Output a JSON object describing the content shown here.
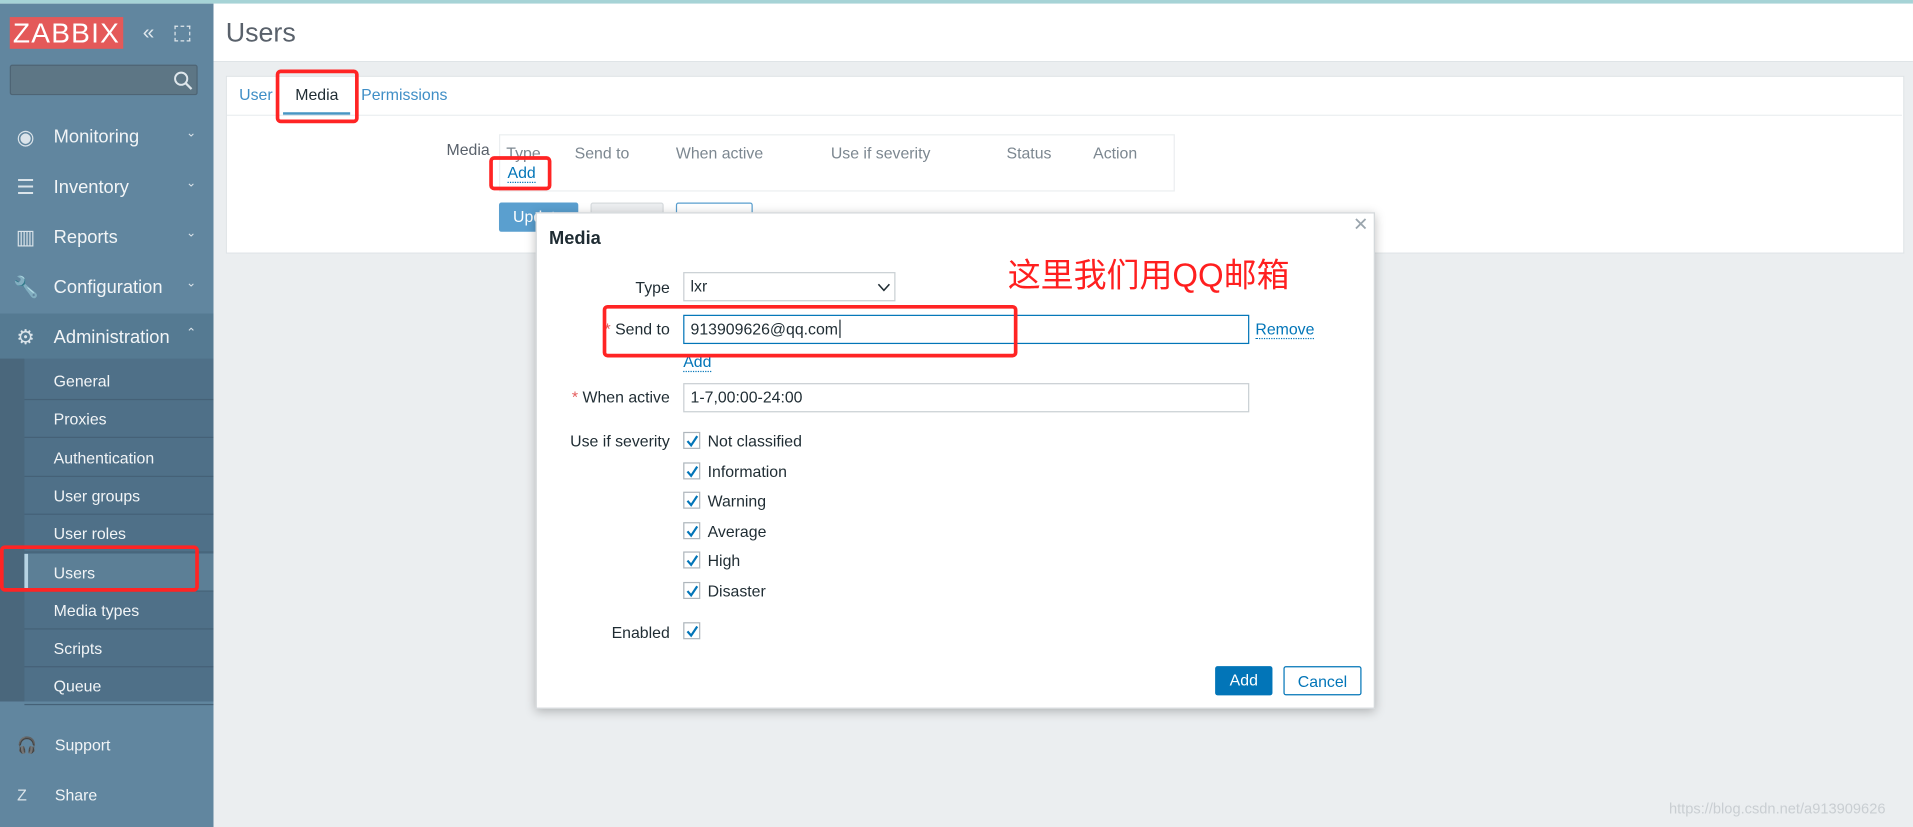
{
  "brand": {
    "logo": "ZABBIX"
  },
  "sidebar": {
    "search_placeholder": "",
    "menu": [
      {
        "label": "Monitoring",
        "icon": "eye-icon"
      },
      {
        "label": "Inventory",
        "icon": "list-icon"
      },
      {
        "label": "Reports",
        "icon": "bar-chart-icon"
      },
      {
        "label": "Configuration",
        "icon": "wrench-icon"
      },
      {
        "label": "Administration",
        "icon": "gear-icon",
        "expanded": true
      }
    ],
    "admin_items": [
      "General",
      "Proxies",
      "Authentication",
      "User groups",
      "User roles",
      "Users",
      "Media types",
      "Scripts",
      "Queue"
    ],
    "selected": "Users",
    "footer": [
      {
        "label": "Support",
        "icon": "headset-icon"
      },
      {
        "label": "Share",
        "icon": "zabbix-share-icon"
      }
    ]
  },
  "page": {
    "title": "Users"
  },
  "tabs": [
    {
      "label": "User"
    },
    {
      "label": "Media",
      "active": true
    },
    {
      "label": "Permissions"
    }
  ],
  "media_section": {
    "label": "Media",
    "columns": [
      "Type",
      "Send to",
      "When active",
      "Use if severity",
      "Status",
      "Action"
    ],
    "add_link": "Add",
    "buttons": [
      "Update",
      "",
      ""
    ]
  },
  "dialog": {
    "title": "Media",
    "type_label": "Type",
    "type_value": "lxr",
    "send_to_label": "Send to",
    "send_to_value": "913909626@qq.com",
    "remove_link": "Remove",
    "add_link": "Add",
    "when_active_label": "When active",
    "when_active_value": "1-7,00:00-24:00",
    "severity_label": "Use if severity",
    "severities": [
      {
        "label": "Not classified",
        "checked": true
      },
      {
        "label": "Information",
        "checked": true
      },
      {
        "label": "Warning",
        "checked": true
      },
      {
        "label": "Average",
        "checked": true
      },
      {
        "label": "High",
        "checked": true
      },
      {
        "label": "Disaster",
        "checked": true
      }
    ],
    "enabled_label": "Enabled",
    "enabled": true,
    "add_button": "Add",
    "cancel_button": "Cancel"
  },
  "annotation": {
    "text": "这里我们用QQ邮箱",
    "color": "#ff1f1f"
  },
  "watermark": "https://blog.csdn.net/a913909626",
  "colors": {
    "sidebar": "#61869f",
    "accent": "#0275b8",
    "logo": "#e45959"
  }
}
